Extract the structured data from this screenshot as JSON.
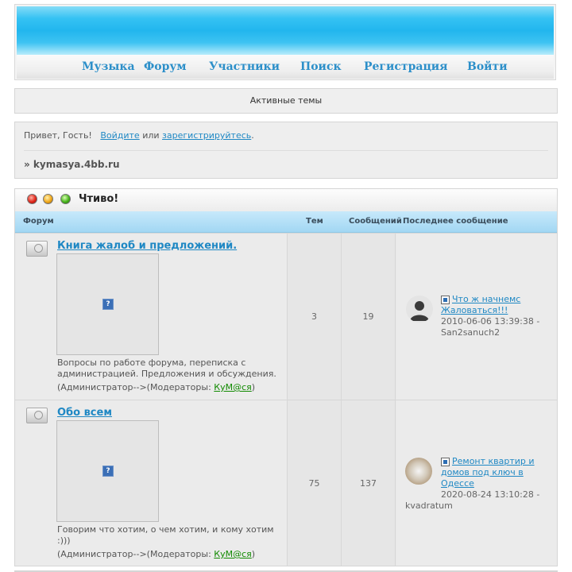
{
  "nav": {
    "music": "Музыка",
    "forum": "Форум",
    "members": "Участники",
    "search": "Поиск",
    "register": "Регистрация",
    "login": "Войти"
  },
  "active_topics": "Активные темы",
  "welcome": {
    "greeting": "Привет, Гость!",
    "login_link": "Войдите",
    "or": "или",
    "register_link": "зарегистрируйтесь",
    "period": ".",
    "breadcrumb": "» kymasya.4bb.ru"
  },
  "category": {
    "title": "Чтиво!",
    "columns": {
      "forum": "Форум",
      "topics": "Тем",
      "posts": "Сообщений",
      "last": "Последнее сообщение"
    },
    "forums": [
      {
        "title": "Книга жалоб и предложений.",
        "description": "Вопросы по работе форума, переписка с администрацией. Предложения и обсуждения.",
        "mods_prefix": "(Администратор-->(Модераторы: ",
        "moderator": "КуМ@ся",
        "mods_suffix": ")",
        "topics": "3",
        "posts": "19",
        "last_title": "Что ж начнемс Жаловаться!!!",
        "last_date": "2010-06-06 13:39:38 -",
        "last_author": "San2sanuch2"
      },
      {
        "title": "Обо всем",
        "description": "Говорим что хотим, о чем хотим, и кому хотим :)))",
        "mods_prefix": "(Администратор-->(Модераторы: ",
        "moderator": "КуМ@ся",
        "mods_suffix": ")",
        "topics": "75",
        "posts": "137",
        "last_title": "Ремонт квартир и домов под ключ в Одессе",
        "last_date": "2020-08-24 13:10:28 -",
        "last_author": "kvadratum"
      }
    ]
  }
}
